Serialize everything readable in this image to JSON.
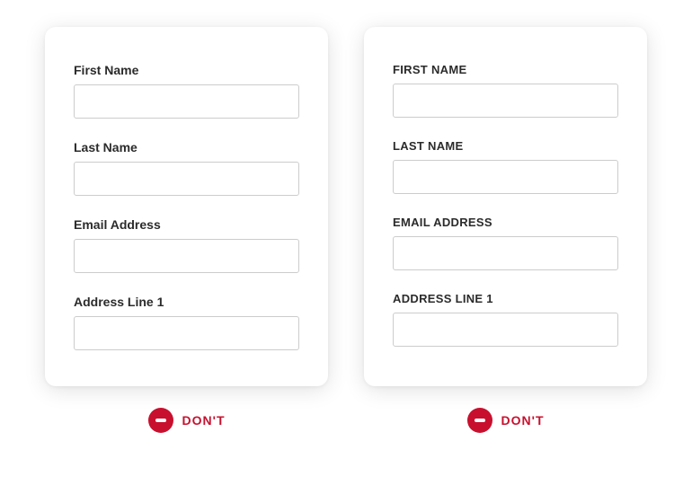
{
  "cards": {
    "left": {
      "fields": [
        {
          "label": "First Name"
        },
        {
          "label": "Last Name"
        },
        {
          "label": "Email Address"
        },
        {
          "label": "Address Line 1"
        }
      ]
    },
    "right": {
      "fields": [
        {
          "label": "FIRST NAME"
        },
        {
          "label": "LAST NAME"
        },
        {
          "label": "EMAIL ADDRESS"
        },
        {
          "label": "ADDRESS LINE 1"
        }
      ]
    }
  },
  "footer": {
    "left": {
      "label": "DON'T"
    },
    "right": {
      "label": "DON'T"
    }
  },
  "colors": {
    "dont": "#c8102e"
  }
}
